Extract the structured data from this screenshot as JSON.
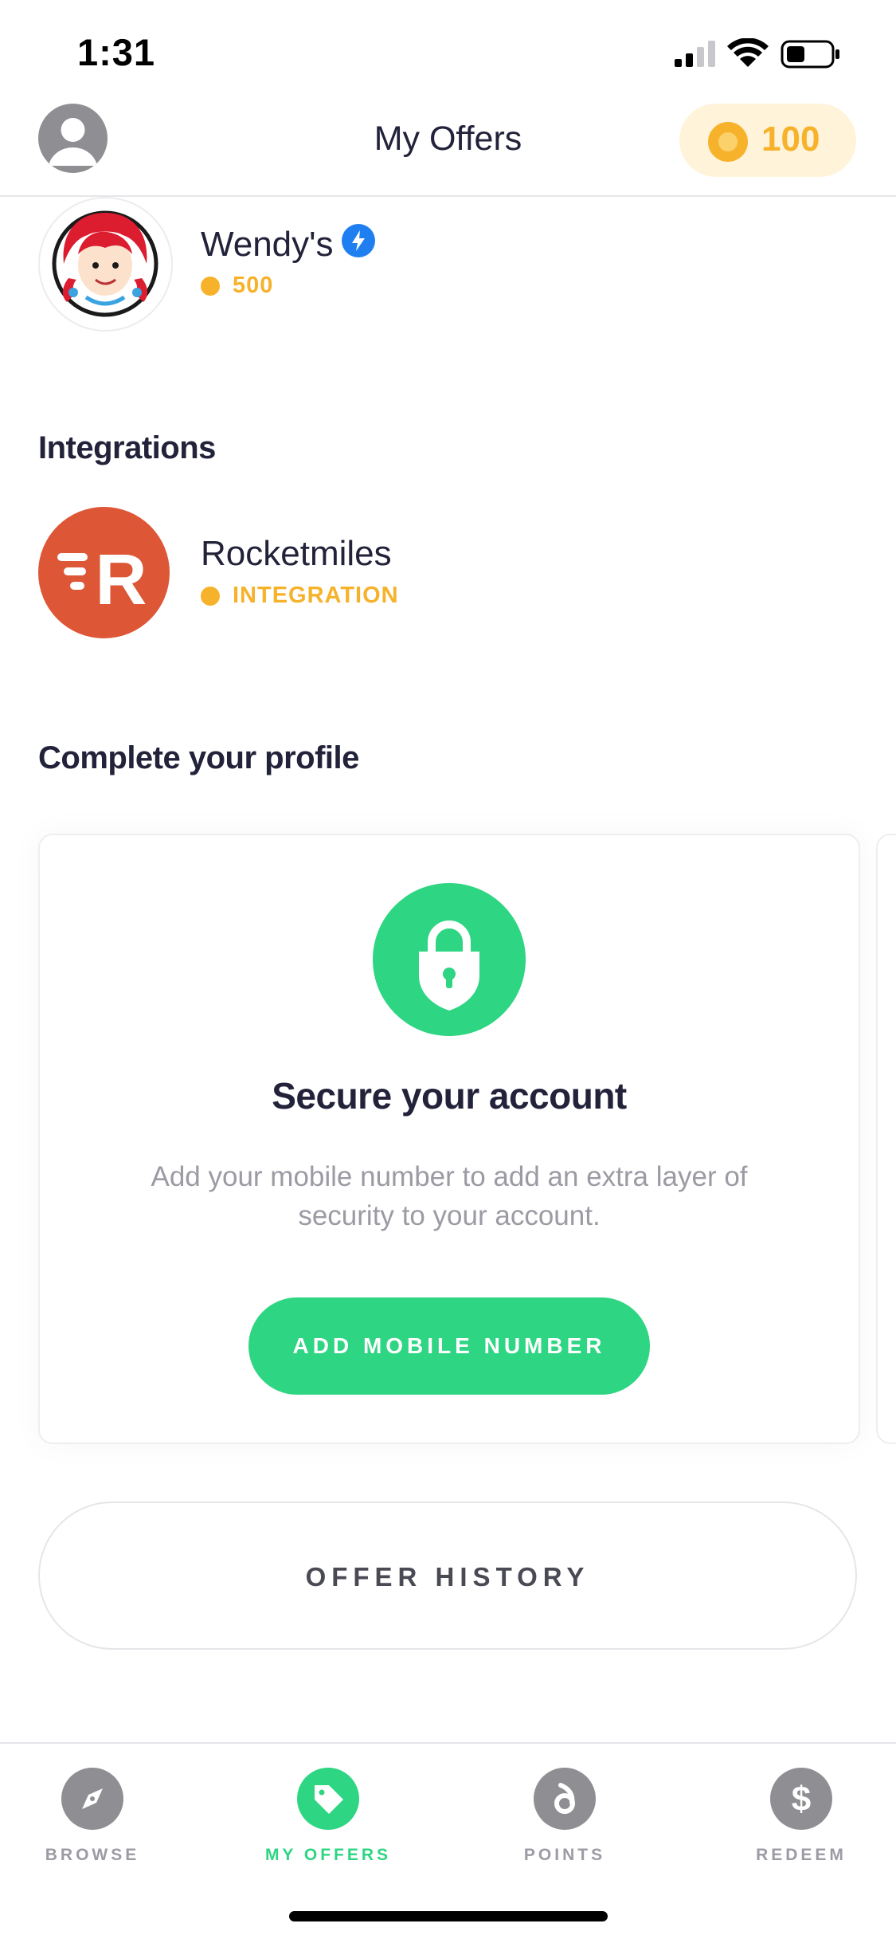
{
  "status_bar": {
    "time": "1:31"
  },
  "header": {
    "title": "My Offers",
    "points": "100"
  },
  "offers": [
    {
      "name": "Wendy's",
      "points": "500",
      "verified": true
    }
  ],
  "integrations": {
    "title": "Integrations",
    "items": [
      {
        "name": "Rocketmiles",
        "tag": "INTEGRATION",
        "logo_letter": "R"
      }
    ]
  },
  "profile": {
    "title": "Complete your profile",
    "card": {
      "title": "Secure your account",
      "description": "Add your mobile number to add an extra layer of security to your account.",
      "button": "ADD MOBILE NUMBER"
    }
  },
  "offer_history_button": "OFFER HISTORY",
  "tabs": [
    {
      "label": "BROWSE",
      "icon": "compass-icon",
      "active": false
    },
    {
      "label": "MY OFFERS",
      "icon": "tag-icon",
      "active": true
    },
    {
      "label": "POINTS",
      "icon": "points-icon",
      "active": false
    },
    {
      "label": "REDEEM",
      "icon": "dollar-icon",
      "active": false
    }
  ],
  "colors": {
    "accent": "#2ed582",
    "coin": "#f7b22b",
    "text": "#22223a",
    "rocketmiles": "#dd5636"
  }
}
